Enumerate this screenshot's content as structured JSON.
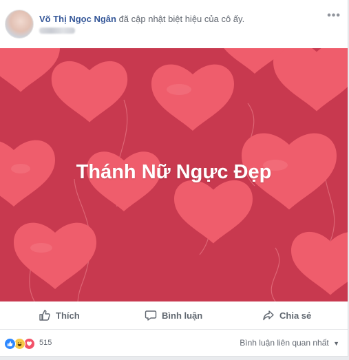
{
  "post": {
    "author_name": "Võ Thị Ngọc Ngân",
    "action_text": "đã cập nhật biệt hiệu của cô ấy.",
    "more_icon": "more-horizontal-icon"
  },
  "banner": {
    "text": "Thánh Nữ Ngực Đẹp",
    "background_color": "#c8394f",
    "heart_color": "#f26471"
  },
  "actions": {
    "like_label": "Thích",
    "comment_label": "Bình luận",
    "share_label": "Chia sẻ"
  },
  "reactions": {
    "icons": [
      "like-reaction-icon",
      "haha-reaction-icon",
      "love-reaction-icon"
    ],
    "count": "515",
    "sort_label": "Bình luận liên quan nhất"
  }
}
